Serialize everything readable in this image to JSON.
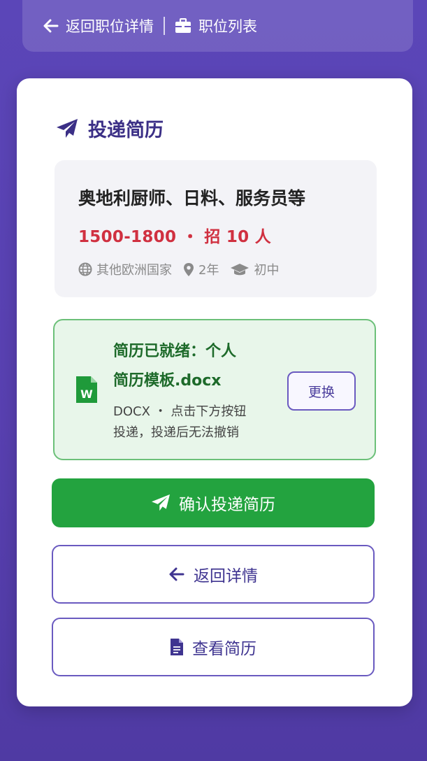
{
  "topnav": {
    "back_label": "返回职位详情",
    "list_label": "职位列表"
  },
  "card": {
    "title": "投递简历"
  },
  "job": {
    "title": "奥地利厨师、日料、服务员等",
    "salary": "1500-1800",
    "separator": "・",
    "headcount": "招 10 人",
    "location": "其他欧洲国家",
    "experience": "2年",
    "education": "初中"
  },
  "resume": {
    "title_line1": "简历已就绪：个人",
    "title_line2": "简历模板.docx",
    "sub_line1": "DOCX ・ 点击下方按钮",
    "sub_line2": "投递，投递后无法撤销",
    "change_label": "更换",
    "icon_letter": "W"
  },
  "buttons": {
    "confirm_label": "确认投递简历",
    "back_label": "返回详情",
    "view_label": "查看简历"
  },
  "colors": {
    "primary": "#3b2f86",
    "success": "#23a33f",
    "salary": "#d03040",
    "outline": "#6a5ac0"
  },
  "icons": [
    "arrow-left-icon",
    "briefcase-icon",
    "paper-plane-icon",
    "globe-icon",
    "map-pin-icon",
    "graduation-cap-icon",
    "word-doc-icon",
    "file-icon"
  ]
}
